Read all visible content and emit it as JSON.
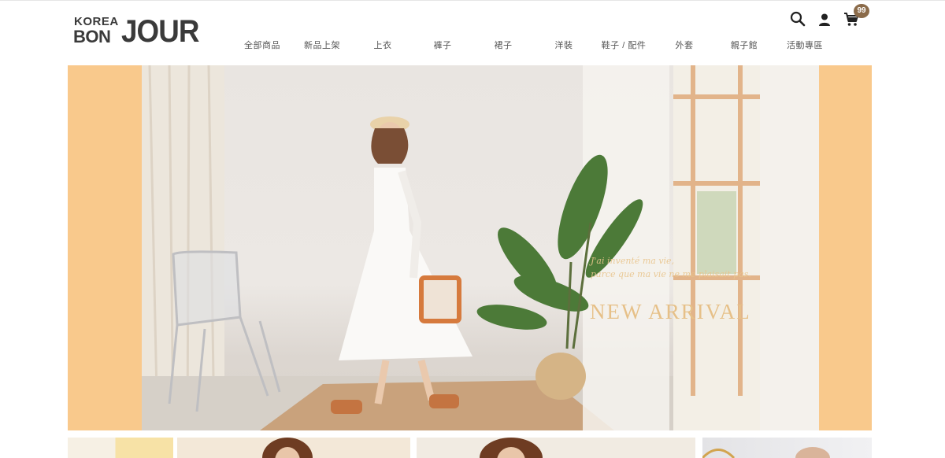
{
  "logo": {
    "line1": "KOREA",
    "line2a": "BON",
    "line2b": "JOUR"
  },
  "nav": {
    "items": [
      {
        "label": "全部商品"
      },
      {
        "label": "新品上架"
      },
      {
        "label": "上衣"
      },
      {
        "label": "褲子"
      },
      {
        "label": "裙子"
      },
      {
        "label": "洋裝"
      },
      {
        "label": "鞋子 / 配件"
      },
      {
        "label": "外套"
      },
      {
        "label": "親子館"
      },
      {
        "label": "活動專區"
      }
    ]
  },
  "header_icons": {
    "search": "search-icon",
    "account": "user-icon",
    "cart": "cart-icon",
    "cart_count": "99"
  },
  "hero": {
    "script_line1": "J'ai inventé ma vie,",
    "script_line2": "parce que ma vie ne me plaisait pas.",
    "title": "NEW ARRIVAL",
    "side_color": "#f9c98c",
    "accent_color": "#e6c088"
  },
  "colors": {
    "logo": "#3a3a3a",
    "badge": "#8b6b4a",
    "nav_text": "#555555"
  }
}
